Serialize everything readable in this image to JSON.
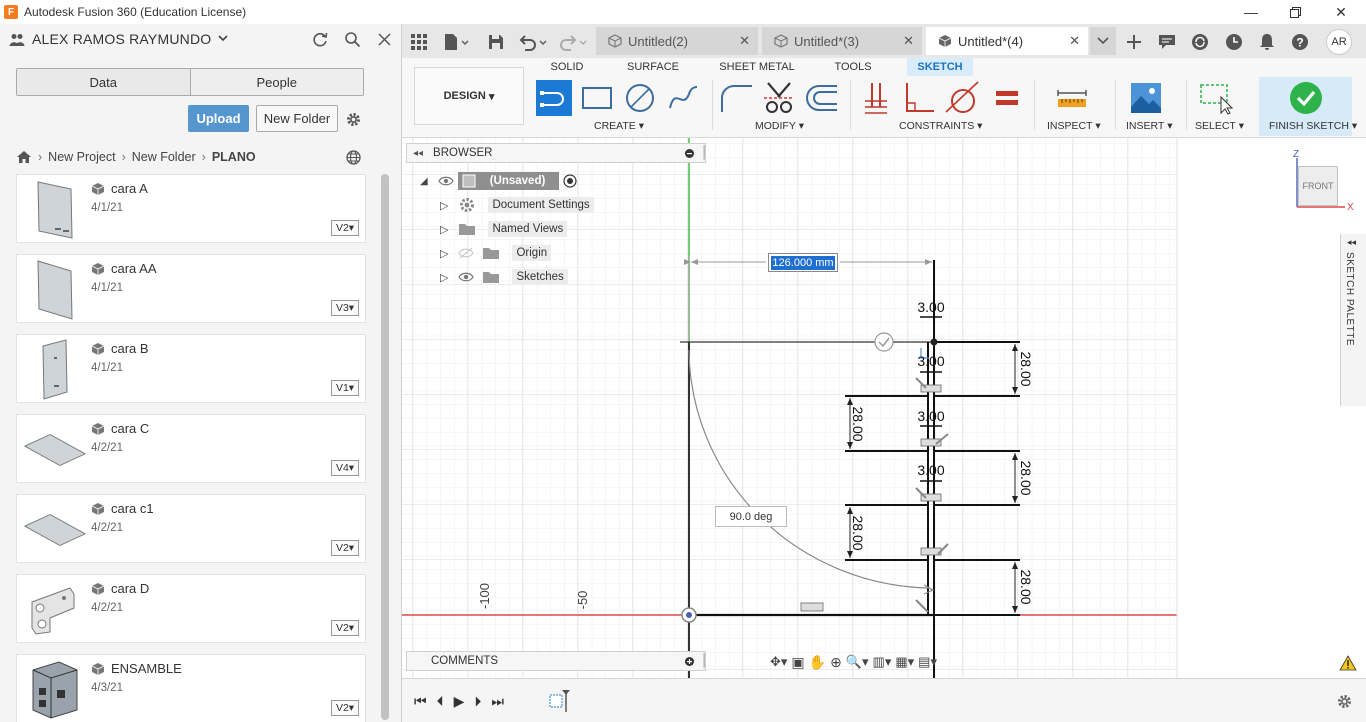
{
  "window": {
    "title": "Autodesk Fusion 360 (Education License)",
    "app_icon": "F"
  },
  "data_panel": {
    "user": "ALEX RAMOS RAYMUNDO",
    "tabs": [
      "Data",
      "People"
    ],
    "upload_label": "Upload",
    "new_folder_label": "New Folder",
    "breadcrumb": [
      "New Project",
      "New Folder",
      "PLANO"
    ],
    "files": [
      {
        "name": "cara A",
        "date": "4/1/21",
        "version": "V2"
      },
      {
        "name": "cara AA",
        "date": "4/1/21",
        "version": "V3"
      },
      {
        "name": "cara B",
        "date": "4/1/21",
        "version": "V1"
      },
      {
        "name": "cara C",
        "date": "4/2/21",
        "version": "V4"
      },
      {
        "name": "cara c1",
        "date": "4/2/21",
        "version": "V2"
      },
      {
        "name": "cara D",
        "date": "4/2/21",
        "version": "V2"
      },
      {
        "name": "ENSAMBLE",
        "date": "4/3/21",
        "version": "V2"
      }
    ]
  },
  "doc_tabs": [
    {
      "label": "Untitled(2)",
      "active": false
    },
    {
      "label": "Untitled*(3)",
      "active": false
    },
    {
      "label": "Untitled*(4)",
      "active": true
    }
  ],
  "user_initials": "AR",
  "ribbon": {
    "workspace": "DESIGN",
    "tabs": [
      "SOLID",
      "SURFACE",
      "SHEET METAL",
      "TOOLS",
      "SKETCH"
    ],
    "active_tab": "SKETCH",
    "groups": [
      "CREATE",
      "MODIFY",
      "CONSTRAINTS",
      "INSPECT",
      "INSERT",
      "SELECT",
      "FINISH SKETCH"
    ]
  },
  "browser": {
    "title": "BROWSER",
    "root": "(Unsaved)",
    "items": [
      "Document Settings",
      "Named Views",
      "Origin",
      "Sketches"
    ]
  },
  "comments_label": "COMMENTS",
  "viewcube_label": "FRONT",
  "axis": {
    "z": "Z",
    "x": "X"
  },
  "sketch_palette_label": "SKETCH PALETTE",
  "sketch": {
    "dimension_input": "126.000 mm",
    "angle_label": "90.0 deg",
    "thickness_dims": [
      "3.00",
      "3.00",
      "3.00",
      "3.00"
    ],
    "spacing_dims": [
      "28.00",
      "28.00",
      "28.00",
      "28.00",
      "28.00"
    ],
    "ruler_labels": [
      "-100",
      "-50"
    ]
  },
  "colors": {
    "accent": "#1a73c5",
    "upload": "#5596cf",
    "finish_check": "#2db34a",
    "x_axis": "#e04848",
    "y_axis": "#41c24a"
  }
}
